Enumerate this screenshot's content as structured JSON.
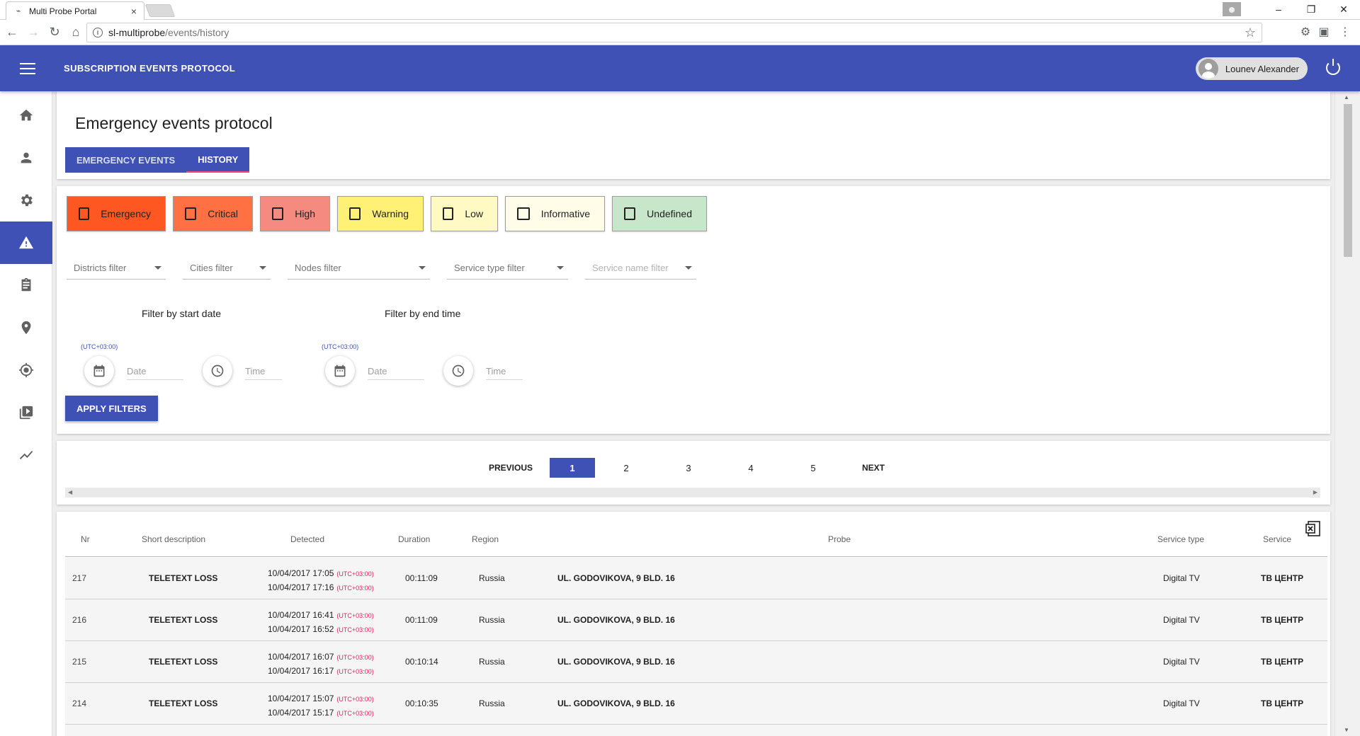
{
  "browser": {
    "tab_title": "Multi Probe Portal",
    "tab_close": "×",
    "url_host": "sl-multiprobe",
    "url_path": "/events/history"
  },
  "appbar": {
    "title": "SUBSCRIPTION EVENTS PROTOCOL",
    "user_name": "Lounev Alexander",
    "color": "#3f51b5"
  },
  "sidebar": {
    "items": [
      {
        "icon": "home-icon"
      },
      {
        "icon": "person-icon"
      },
      {
        "icon": "gear-icon"
      },
      {
        "icon": "warning-icon",
        "active": true
      },
      {
        "icon": "clipboard-icon"
      },
      {
        "icon": "location-pin-icon"
      },
      {
        "icon": "crosshair-icon"
      },
      {
        "icon": "video-library-icon"
      },
      {
        "icon": "trending-icon"
      }
    ]
  },
  "page": {
    "title": "Emergency events protocol",
    "tabs": [
      {
        "label": "EMERGENCY EVENTS"
      },
      {
        "label": "HISTORY",
        "active": true
      }
    ]
  },
  "severity": [
    {
      "label": "Emergency",
      "color": "#ff5722"
    },
    {
      "label": "Critical",
      "color": "#ff7043"
    },
    {
      "label": "High",
      "color": "#f48a80"
    },
    {
      "label": "Warning",
      "color": "#fff176"
    },
    {
      "label": "Low",
      "color": "#fff9c4"
    },
    {
      "label": "Informative",
      "color": "#fffde7"
    },
    {
      "label": "Undefined",
      "color": "#c8e6c9"
    }
  ],
  "filters": {
    "districts": "Districts filter",
    "cities": "Cities filter",
    "nodes": "Nodes filter",
    "service_type": "Service type filter",
    "service_name": "Service name filter",
    "start_label": "Filter by start date",
    "end_label": "Filter by end time",
    "timezone": "(UTC+03:00)",
    "date_placeholder": "Date",
    "time_placeholder": "Time",
    "apply": "APPLY FILTERS"
  },
  "pager": {
    "previous": "PREVIOUS",
    "next": "NEXT",
    "pages": [
      "1",
      "2",
      "3",
      "4",
      "5"
    ],
    "current": "1"
  },
  "table": {
    "headers": {
      "nr": "Nr",
      "desc": "Short description",
      "detected": "Detected",
      "duration": "Duration",
      "region": "Region",
      "probe": "Probe",
      "service_type": "Service type",
      "service": "Service"
    },
    "tz": "(UTC+03:00)",
    "rows": [
      {
        "nr": "217",
        "desc": "TELETEXT LOSS",
        "start": "10/04/2017 17:05",
        "end": "10/04/2017 17:16",
        "duration": "00:11:09",
        "region": "Russia",
        "probe": "UL. GODOVIKOVA, 9 BLD. 16",
        "service_type": "Digital TV",
        "service": "ТВ ЦЕНТР"
      },
      {
        "nr": "216",
        "desc": "TELETEXT LOSS",
        "start": "10/04/2017 16:41",
        "end": "10/04/2017 16:52",
        "duration": "00:11:09",
        "region": "Russia",
        "probe": "UL. GODOVIKOVA, 9 BLD. 16",
        "service_type": "Digital TV",
        "service": "ТВ ЦЕНТР"
      },
      {
        "nr": "215",
        "desc": "TELETEXT LOSS",
        "start": "10/04/2017 16:07",
        "end": "10/04/2017 16:17",
        "duration": "00:10:14",
        "region": "Russia",
        "probe": "UL. GODOVIKOVA, 9 BLD. 16",
        "service_type": "Digital TV",
        "service": "ТВ ЦЕНТР"
      },
      {
        "nr": "214",
        "desc": "TELETEXT LOSS",
        "start": "10/04/2017 15:07",
        "end": "10/04/2017 15:17",
        "duration": "00:10:35",
        "region": "Russia",
        "probe": "UL. GODOVIKOVA, 9 BLD. 16",
        "service_type": "Digital TV",
        "service": "ТВ ЦЕНТР"
      },
      {
        "nr": "",
        "desc": "",
        "start": "",
        "end": "",
        "duration": "",
        "region": "",
        "probe": "",
        "service_type": "",
        "service": ""
      }
    ]
  }
}
